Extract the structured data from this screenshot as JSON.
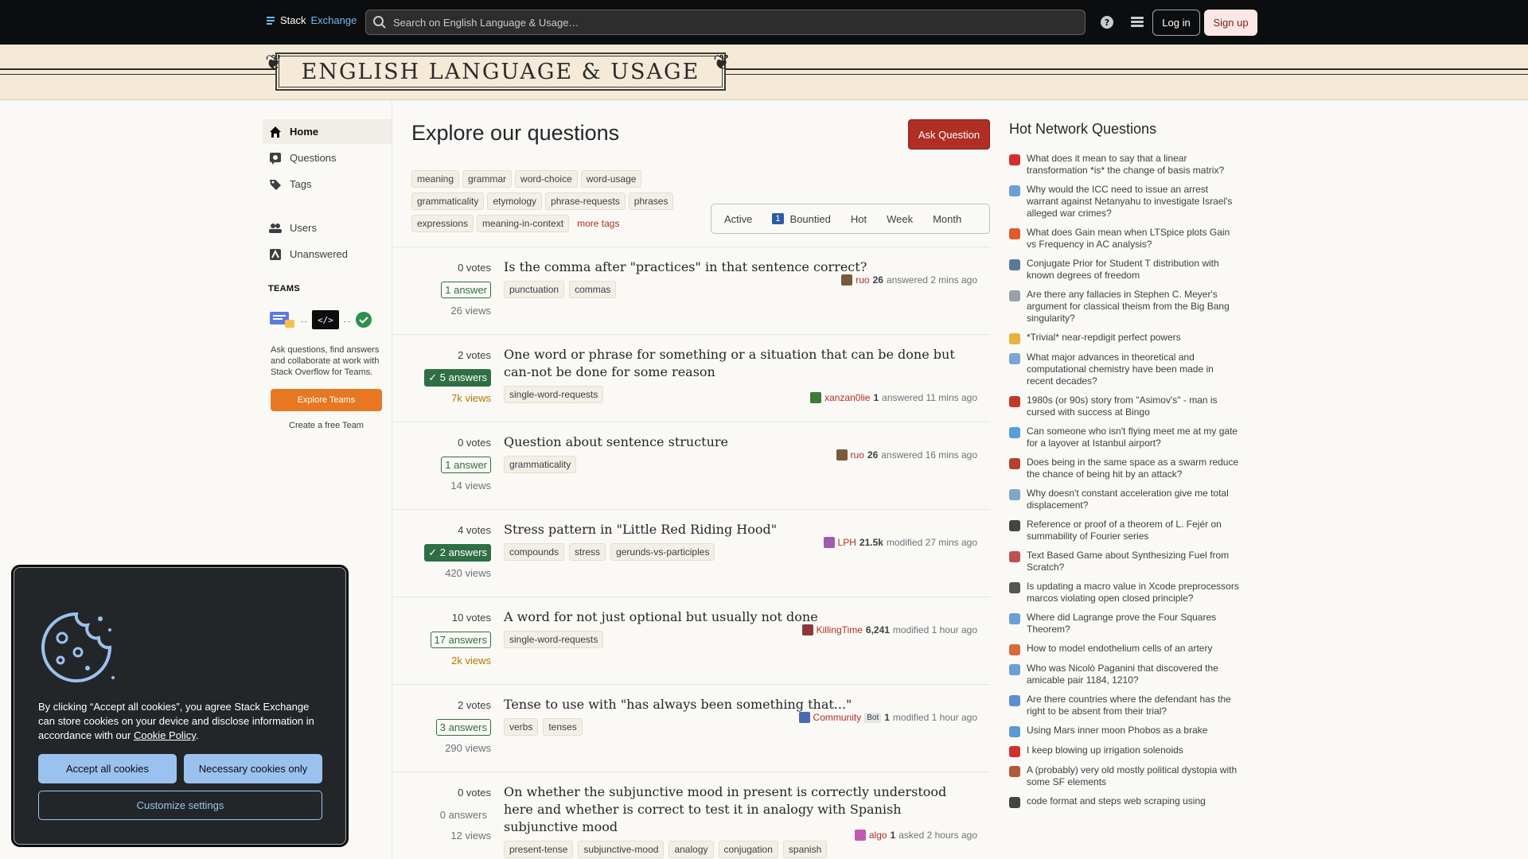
{
  "header": {
    "logo_stack": "Stack",
    "logo_exchange": "Exchange",
    "search_placeholder": "Search on English Language & Usage…",
    "login_label": "Log in",
    "signup_label": "Sign up"
  },
  "banner": {
    "site_title": "ENGLISH LANGUAGE & USAGE"
  },
  "nav": {
    "items": [
      {
        "label": "Home",
        "icon": "home-icon"
      },
      {
        "label": "Questions",
        "icon": "questions-icon"
      },
      {
        "label": "Tags",
        "icon": "tag-icon"
      },
      {
        "label": "Users",
        "icon": "users-icon"
      },
      {
        "label": "Unanswered",
        "icon": "unanswered-icon"
      }
    ],
    "teams_heading": "TEAMS",
    "teams_text": "Ask questions, find answers and collaborate at work with Stack Overflow for Teams.",
    "explore_teams": "Explore Teams",
    "create_team": "Create a free Team"
  },
  "main": {
    "title": "Explore our questions",
    "ask_button": "Ask Question",
    "tags_row1": [
      "meaning",
      "grammar",
      "word-choice",
      "word-usage"
    ],
    "tags_row2": [
      "grammaticality",
      "etymology",
      "phrase-requests",
      "phrases"
    ],
    "tags_row3": [
      "expressions",
      "meaning-in-context"
    ],
    "more_tags": "more tags",
    "filters": {
      "active": "Active",
      "bountied_count": "1",
      "bountied": "Bountied",
      "hot": "Hot",
      "week": "Week",
      "month": "Month"
    }
  },
  "questions": [
    {
      "votes": "0 votes",
      "answers": "1 answer",
      "answers_state": "answered",
      "views": "26 views",
      "title": "Is the comma after \"practices\" in that sentence correct?",
      "tags": [
        "punctuation",
        "commas"
      ],
      "user": "ruo",
      "rep": "26",
      "action": "answered 2 mins ago"
    },
    {
      "votes": "2 votes",
      "answers": "5 answers",
      "answers_state": "accepted",
      "views": "7k views",
      "views_hot": true,
      "title": "One word or phrase for something or a situation that can be done but can-not be done for some reason",
      "tags": [
        "single-word-requests"
      ],
      "user": "xanzan0lie",
      "rep": "1",
      "action": "answered 11 mins ago"
    },
    {
      "votes": "0 votes",
      "answers": "1 answer",
      "answers_state": "answered",
      "views": "14 views",
      "title": "Question about sentence structure",
      "tags": [
        "grammaticality"
      ],
      "user": "ruo",
      "rep": "26",
      "action": "answered 16 mins ago"
    },
    {
      "votes": "4 votes",
      "answers": "2 answers",
      "answers_state": "accepted",
      "views": "420 views",
      "title": "Stress pattern in \"Little Red Riding Hood\"",
      "tags": [
        "compounds",
        "stress",
        "gerunds-vs-participles"
      ],
      "user": "LPH",
      "rep": "21.5k",
      "action": "modified 27 mins ago"
    },
    {
      "votes": "10 votes",
      "answers": "17 answers",
      "answers_state": "answered",
      "views": "2k views",
      "views_hot": true,
      "title": "A word for not just optional but usually not done",
      "tags": [
        "single-word-requests"
      ],
      "user": "KillingTime",
      "rep": "6,241",
      "action": "modified 1 hour ago"
    },
    {
      "votes": "2 votes",
      "answers": "3 answers",
      "answers_state": "answered",
      "views": "290 views",
      "title": "Tense to use with \"has always been something that...\"",
      "tags": [
        "verbs",
        "tenses"
      ],
      "user": "Community",
      "bot": "Bot",
      "rep": "1",
      "action": "modified 1 hour ago"
    },
    {
      "votes": "0 votes",
      "answers": "0 answers",
      "answers_state": "none",
      "views": "12 views",
      "title": "On whether the subjunctive mood in present is correctly understood here and whether is correct to test it in analogy with Spanish subjunctive mood",
      "tags": [
        "present-tense",
        "subjunctive-mood",
        "analogy",
        "conjugation",
        "spanish"
      ],
      "user": "algo",
      "rep": "1",
      "action": "asked 2 hours ago"
    }
  ],
  "hnq": {
    "title": "Hot Network Questions",
    "items": [
      {
        "text": "What does it mean to say that a linear transformation *is* the change of basis matrix?",
        "color": "#d0312d"
      },
      {
        "text": "Why would the ICC need to issue an arrest warrant against Netanyahu to investigate Israel's alleged war crimes?",
        "color": "#6a9fd8"
      },
      {
        "text": "What does Gain mean when LTSpice plots Gain vs Frequency in AC analysis?",
        "color": "#e05a2b"
      },
      {
        "text": "Conjugate Prior for Student T distribution with known degrees of freedom",
        "color": "#5a7a9a"
      },
      {
        "text": "Are there any fallacies in Stephen C. Meyer's argument for classical theism from the Big Bang singularity?",
        "color": "#9aa0a6"
      },
      {
        "text": "*Trivial* near-repdigit perfect powers",
        "color": "#e8b23a"
      },
      {
        "text": "What major advances in theoretical and computational chemistry have been made in recent decades?",
        "color": "#7aa6d8"
      },
      {
        "text": "1980s (or 90s) story from \"Asimov's\" - man is cursed with success at Bingo",
        "color": "#c0392b"
      },
      {
        "text": "Can someone who isn't flying meet me at my gate for a layover at Istanbul airport?",
        "color": "#55a0d8"
      },
      {
        "text": "Does being in the same space as a swarm reduce the chance of being hit by an attack?",
        "color": "#b5402f"
      },
      {
        "text": "Why doesn't constant acceleration give me total displacement?",
        "color": "#7fa7c9"
      },
      {
        "text": "Reference or proof of a theorem of L. Fejér on summability of Fourier series",
        "color": "#444444"
      },
      {
        "text": "Text Based Game about Synthesizing Fuel from Scratch?",
        "color": "#c05050"
      },
      {
        "text": "Is updating a macro value in Xcode preprocessors marcos violating open closed principle?",
        "color": "#555555"
      },
      {
        "text": "Where did Lagrange prove the Four Squares Theorem?",
        "color": "#6a9fd8"
      },
      {
        "text": "How to model endothelium cells of an artery",
        "color": "#d86a3a"
      },
      {
        "text": "Who was Nicolò Paganini that discovered the amicable pair 1184, 1210?",
        "color": "#6a9fd8"
      },
      {
        "text": "Are there countries where the defendant has the right to be absent from their trial?",
        "color": "#5b8fd0"
      },
      {
        "text": "Using Mars inner moon Phobos as a brake",
        "color": "#5b9bd5"
      },
      {
        "text": "I keep blowing up irrigation solenoids",
        "color": "#d0312d"
      },
      {
        "text": "A (probably) very old mostly political dystopia with some SF elements",
        "color": "#b05a3a"
      },
      {
        "text": "code format and steps web scraping using",
        "color": "#444444"
      }
    ]
  },
  "cookie": {
    "text_before": "By clicking “Accept all cookies”, you agree Stack Exchange can store cookies on your device and disclose information in accordance with our ",
    "policy_link": "Cookie Policy",
    "text_after": ".",
    "accept_label": "Accept all cookies",
    "necessary_label": "Necessary cookies only",
    "customize_label": "Customize settings"
  }
}
